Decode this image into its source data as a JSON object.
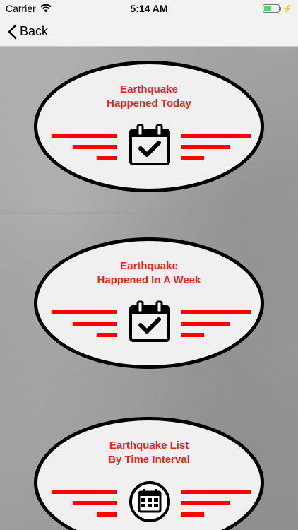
{
  "status_bar": {
    "carrier": "Carrier",
    "time": "5:14 AM",
    "icons": [
      "wifi-icon",
      "battery-icon",
      "charging-bolt-icon"
    ]
  },
  "nav": {
    "back_label": "Back",
    "back_icon": "chevron-left-icon"
  },
  "cards": [
    {
      "title_line1": "Earthquake",
      "title_line2": "Happened Today",
      "icon": "calendar-check-icon"
    },
    {
      "title_line1": "Earthquake",
      "title_line2": "Happened In A Week",
      "icon": "calendar-check-icon"
    },
    {
      "title_line1": "Earthquake List",
      "title_line2": "By Time Interval",
      "icon": "calendar-grid-circle-icon"
    }
  ],
  "colors": {
    "title_red": "#e2281c",
    "bar_red": "#ff0000",
    "card_fill": "#f0f0f0",
    "card_border": "#000000",
    "battery_green": "#4cd964"
  }
}
